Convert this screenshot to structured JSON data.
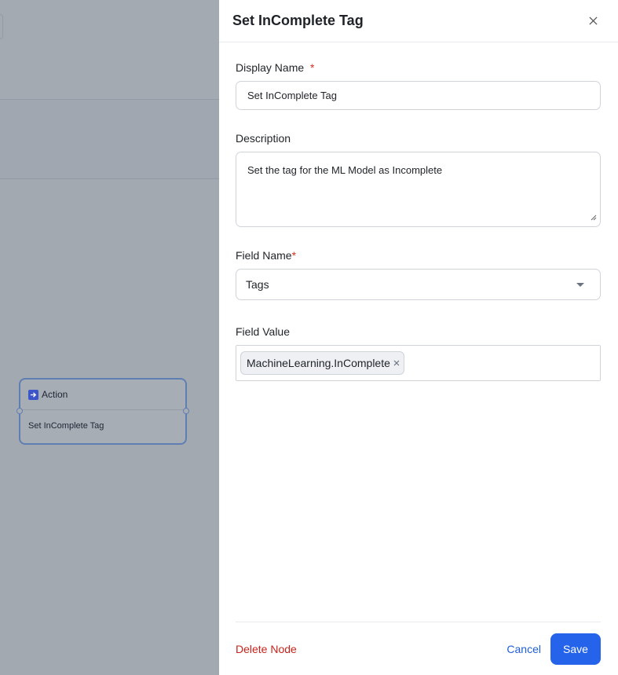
{
  "canvas": {
    "node": {
      "type_label": "Action",
      "name": "Set InComplete Tag",
      "icon": "action-icon"
    }
  },
  "drawer": {
    "title": "Set InComplete Tag",
    "close_icon": "close-icon",
    "display_name": {
      "label": "Display Name",
      "required_mark": "*",
      "value": "Set InComplete Tag"
    },
    "description": {
      "label": "Description",
      "value": "Set the tag for the ML Model as Incomplete"
    },
    "field_name": {
      "label": "Field Name",
      "required_mark": "*",
      "selected": "Tags"
    },
    "field_value": {
      "label": "Field Value",
      "tags": [
        "MachineLearning.InComplete"
      ]
    },
    "footer": {
      "delete_label": "Delete Node",
      "cancel_label": "Cancel",
      "save_label": "Save"
    }
  },
  "colors": {
    "primary": "#2563eb",
    "danger": "#c8231a",
    "link": "#1f5fd6",
    "overlay": "#a3a9b1"
  }
}
